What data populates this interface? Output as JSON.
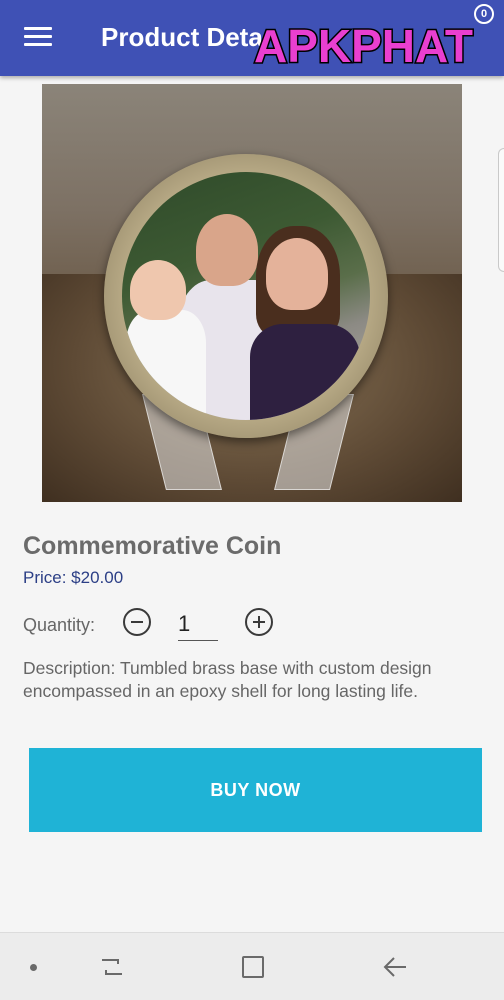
{
  "appbar": {
    "title": "Product Deta",
    "watermark": "APKPHAT",
    "cart_badge": "0",
    "menu_icon": "hamburger-menu-icon"
  },
  "product": {
    "name": "Commemorative Coin",
    "price": "Price: $20.00",
    "quantity_label": "Quantity:",
    "quantity_value": "1",
    "description": "Description: Tumbled brass base with custom design encompassed in an epoxy shell for long lasting life.",
    "image_icon": "product-photo"
  },
  "actions": {
    "buy_now": "BUY NOW"
  },
  "navbar": {
    "icons": [
      "dot-icon",
      "recent-apps-icon",
      "home-icon",
      "back-icon"
    ]
  },
  "colors": {
    "appbar": "#3f51b5",
    "buy_button": "#1fb3d6",
    "price": "#2c3f86"
  }
}
